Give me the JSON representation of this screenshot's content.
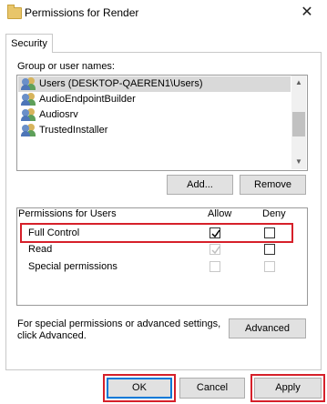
{
  "window": {
    "title": "Permissions for Render",
    "close_glyph": "✕"
  },
  "tabs": [
    {
      "label": "Security"
    }
  ],
  "users": {
    "label": "Group or user names:",
    "items": [
      {
        "label": "Users (DESKTOP-QAEREN1\\Users)",
        "selected": true
      },
      {
        "label": "AudioEndpointBuilder",
        "selected": false
      },
      {
        "label": "Audiosrv",
        "selected": false
      },
      {
        "label": "TrustedInstaller",
        "selected": false
      }
    ],
    "icon": "user-group-icon",
    "add_label": "Add...",
    "remove_label": "Remove"
  },
  "permissions": {
    "header": "Permissions for Users",
    "allow_label": "Allow",
    "deny_label": "Deny",
    "rows": [
      {
        "label": "Full Control",
        "allow": true,
        "allow_disabled": false,
        "deny": false,
        "deny_disabled": false
      },
      {
        "label": "Read",
        "allow": true,
        "allow_disabled": true,
        "deny": false,
        "deny_disabled": false
      },
      {
        "label": "Special permissions",
        "allow": false,
        "allow_disabled": true,
        "deny": false,
        "deny_disabled": true
      }
    ]
  },
  "advanced": {
    "text_line1": "For special permissions or advanced settings,",
    "text_line2": "click Advanced.",
    "button_label": "Advanced"
  },
  "footer": {
    "ok_label": "OK",
    "cancel_label": "Cancel",
    "apply_label": "Apply"
  },
  "colors": {
    "highlight": "#d6202a",
    "ok_border": "#0078d7",
    "selection": "#d9d9d9"
  }
}
